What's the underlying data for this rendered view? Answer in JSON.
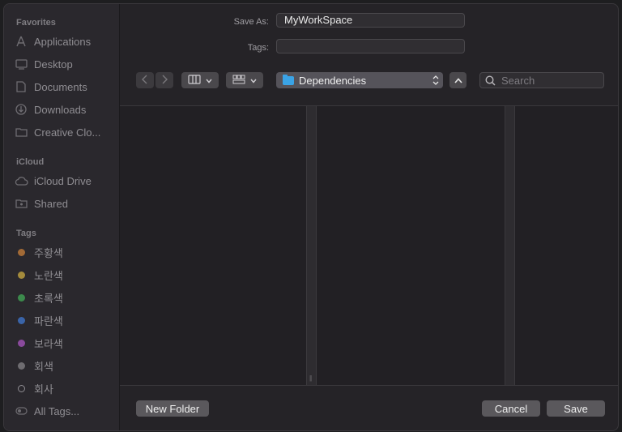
{
  "sidebar": {
    "favorites_header": "Favorites",
    "favorites": [
      {
        "label": "Applications",
        "icon": "applications-icon"
      },
      {
        "label": "Desktop",
        "icon": "desktop-icon"
      },
      {
        "label": "Documents",
        "icon": "document-icon"
      },
      {
        "label": "Downloads",
        "icon": "download-icon"
      },
      {
        "label": "Creative Clo...",
        "icon": "folder-icon"
      }
    ],
    "icloud_header": "iCloud",
    "icloud": [
      {
        "label": "iCloud Drive",
        "icon": "cloud-icon"
      },
      {
        "label": "Shared",
        "icon": "shared-folder-icon"
      }
    ],
    "tags_header": "Tags",
    "tags": [
      {
        "label": "주황색",
        "color": "#a26a36"
      },
      {
        "label": "노란색",
        "color": "#a48b3c"
      },
      {
        "label": "초록색",
        "color": "#3c8a4c"
      },
      {
        "label": "파란색",
        "color": "#3a64a8"
      },
      {
        "label": "보라색",
        "color": "#8a4a9c"
      },
      {
        "label": "회색",
        "color": "#6e6c70"
      },
      {
        "label": "회사",
        "color": "hollow"
      },
      {
        "label": "All Tags...",
        "color": "all-tags"
      }
    ]
  },
  "form": {
    "save_as_label": "Save As:",
    "save_as_value": "MyWorkSpace",
    "tags_label": "Tags:",
    "tags_value": ""
  },
  "toolbar": {
    "location": "Dependencies",
    "search_placeholder": "Search"
  },
  "footer": {
    "new_folder": "New Folder",
    "cancel": "Cancel",
    "save": "Save"
  }
}
